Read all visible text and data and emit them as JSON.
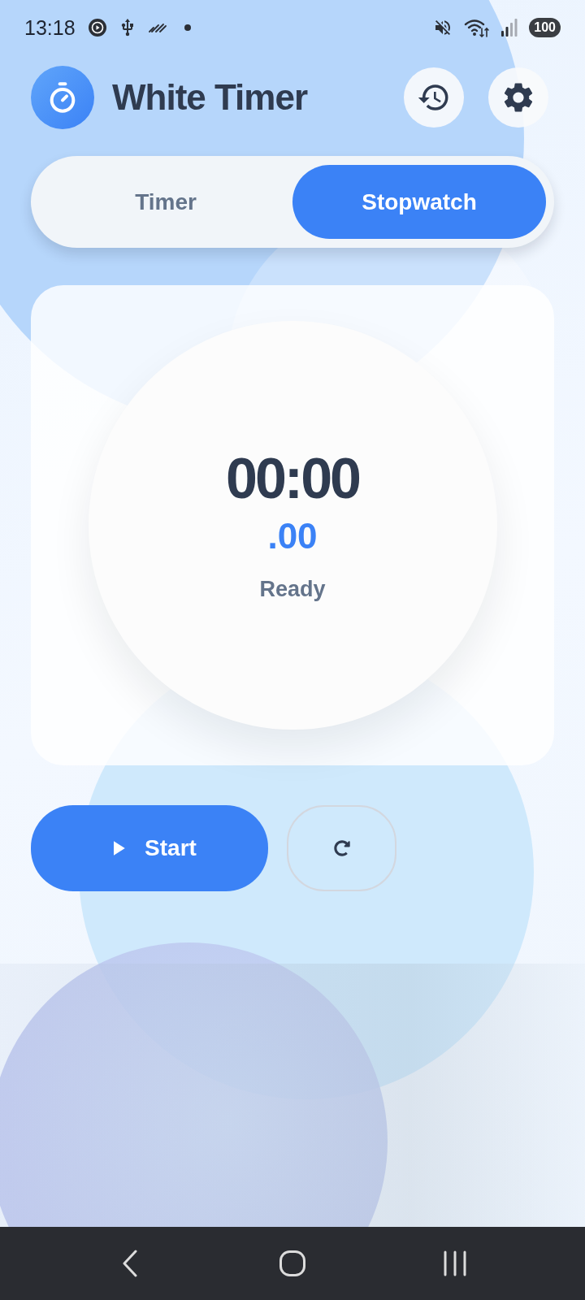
{
  "status_bar": {
    "time": "13:18",
    "battery": "100"
  },
  "header": {
    "title": "White Timer"
  },
  "tabs": [
    {
      "label": "Timer",
      "selected": false
    },
    {
      "label": "Stopwatch",
      "selected": true
    }
  ],
  "display": {
    "time": "00:00",
    "fraction": ".00",
    "status": "Ready"
  },
  "controls": {
    "start_label": "Start"
  }
}
